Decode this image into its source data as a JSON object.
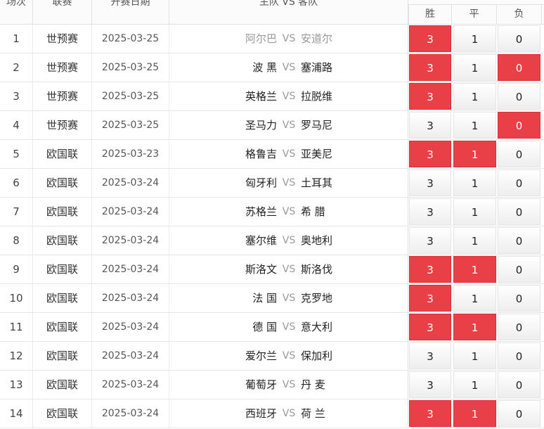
{
  "header": {
    "round": "场次",
    "league": "联赛",
    "date": "开赛日期",
    "match": "主队 VS 客队",
    "win": "胜",
    "draw": "平",
    "loss": "负"
  },
  "rows": [
    {
      "round": "1",
      "league": "世预赛",
      "date": "2025-03-25",
      "home": "阿尔巴",
      "vs": "VS",
      "away": "安道尔",
      "win": "3",
      "draw": "1",
      "loss": "0",
      "win_hit": true,
      "draw_hit": false,
      "loss_hit": false,
      "dim": true
    },
    {
      "round": "2",
      "league": "世预赛",
      "date": "2025-03-25",
      "home": "波 黑",
      "vs": "VS",
      "away": "塞浦路",
      "win": "3",
      "draw": "1",
      "loss": "0",
      "win_hit": true,
      "draw_hit": false,
      "loss_hit": true,
      "dim": false
    },
    {
      "round": "3",
      "league": "世预赛",
      "date": "2025-03-25",
      "home": "英格兰",
      "vs": "VS",
      "away": "拉脱维",
      "win": "3",
      "draw": "1",
      "loss": "0",
      "win_hit": true,
      "draw_hit": false,
      "loss_hit": false,
      "dim": false
    },
    {
      "round": "4",
      "league": "世预赛",
      "date": "2025-03-25",
      "home": "圣马力",
      "vs": "VS",
      "away": "罗马尼",
      "win": "3",
      "draw": "1",
      "loss": "0",
      "win_hit": false,
      "draw_hit": false,
      "loss_hit": true,
      "dim": false
    },
    {
      "round": "5",
      "league": "欧国联",
      "date": "2025-03-23",
      "home": "格鲁吉",
      "vs": "VS",
      "away": "亚美尼",
      "win": "3",
      "draw": "1",
      "loss": "0",
      "win_hit": true,
      "draw_hit": true,
      "loss_hit": false,
      "dim": false
    },
    {
      "round": "6",
      "league": "欧国联",
      "date": "2025-03-24",
      "home": "匈牙利",
      "vs": "VS",
      "away": "土耳其",
      "win": "3",
      "draw": "1",
      "loss": "0",
      "win_hit": false,
      "draw_hit": false,
      "loss_hit": false,
      "dim": false
    },
    {
      "round": "7",
      "league": "欧国联",
      "date": "2025-03-24",
      "home": "苏格兰",
      "vs": "VS",
      "away": "希 腊",
      "win": "3",
      "draw": "1",
      "loss": "0",
      "win_hit": false,
      "draw_hit": false,
      "loss_hit": false,
      "dim": false
    },
    {
      "round": "8",
      "league": "欧国联",
      "date": "2025-03-24",
      "home": "塞尔维",
      "vs": "VS",
      "away": "奥地利",
      "win": "3",
      "draw": "1",
      "loss": "0",
      "win_hit": false,
      "draw_hit": false,
      "loss_hit": false,
      "dim": false
    },
    {
      "round": "9",
      "league": "欧国联",
      "date": "2025-03-24",
      "home": "斯洛文",
      "vs": "VS",
      "away": "斯洛伐",
      "win": "3",
      "draw": "1",
      "loss": "0",
      "win_hit": true,
      "draw_hit": true,
      "loss_hit": false,
      "dim": false
    },
    {
      "round": "10",
      "league": "欧国联",
      "date": "2025-03-24",
      "home": "法 国",
      "vs": "VS",
      "away": "克罗地",
      "win": "3",
      "draw": "1",
      "loss": "0",
      "win_hit": true,
      "draw_hit": false,
      "loss_hit": false,
      "dim": false
    },
    {
      "round": "11",
      "league": "欧国联",
      "date": "2025-03-24",
      "home": "德 国",
      "vs": "VS",
      "away": "意大利",
      "win": "3",
      "draw": "1",
      "loss": "0",
      "win_hit": true,
      "draw_hit": true,
      "loss_hit": false,
      "dim": false
    },
    {
      "round": "12",
      "league": "欧国联",
      "date": "2025-03-24",
      "home": "爱尔兰",
      "vs": "VS",
      "away": "保加利",
      "win": "3",
      "draw": "1",
      "loss": "0",
      "win_hit": false,
      "draw_hit": false,
      "loss_hit": false,
      "dim": false
    },
    {
      "round": "13",
      "league": "欧国联",
      "date": "2025-03-24",
      "home": "葡萄牙",
      "vs": "VS",
      "away": "丹 麦",
      "win": "3",
      "draw": "1",
      "loss": "0",
      "win_hit": false,
      "draw_hit": false,
      "loss_hit": false,
      "dim": false
    },
    {
      "round": "14",
      "league": "欧国联",
      "date": "2025-03-24",
      "home": "西班牙",
      "vs": "VS",
      "away": "荷 兰",
      "win": "3",
      "draw": "1",
      "loss": "0",
      "win_hit": true,
      "draw_hit": true,
      "loss_hit": false,
      "dim": false
    }
  ],
  "colors": {
    "hit": "#e84046",
    "border": "#e2e2e2"
  }
}
